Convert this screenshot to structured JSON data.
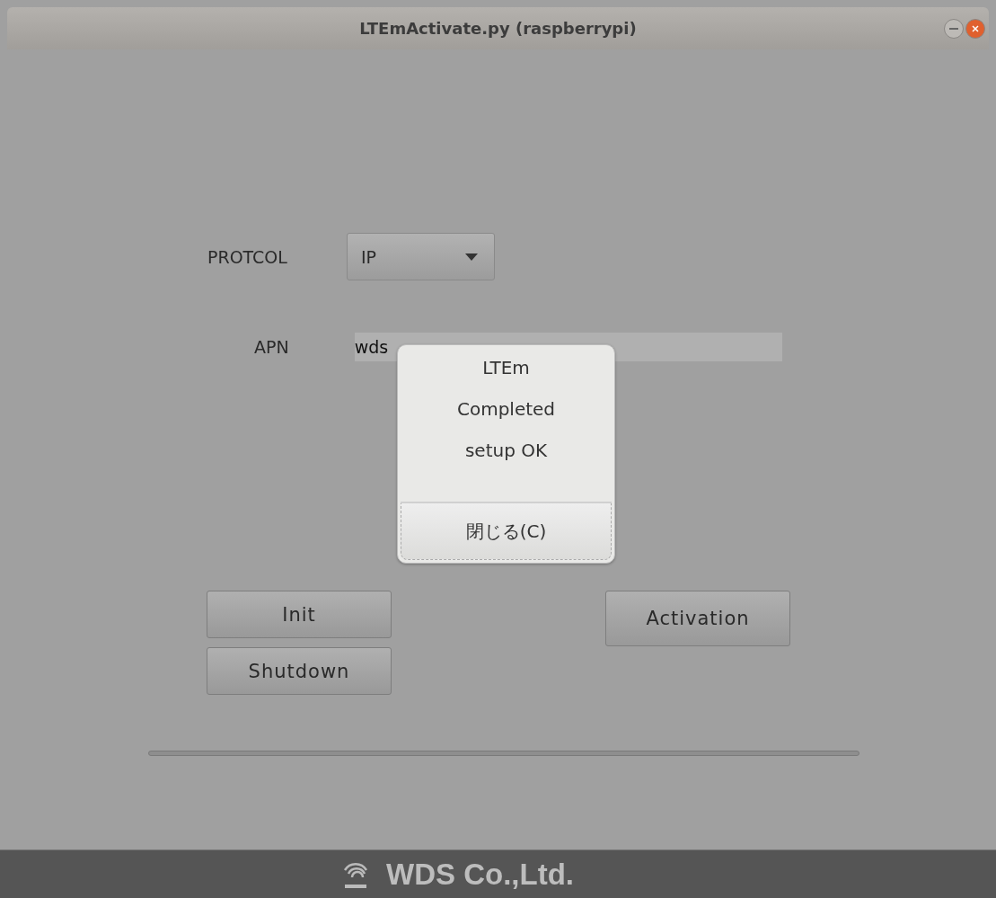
{
  "window": {
    "title": "LTEmActivate.py (raspberrypi)"
  },
  "form": {
    "protocol_label": "PROTCOL",
    "protocol_value": "IP",
    "apn_label": "APN",
    "apn_value": "wds"
  },
  "buttons": {
    "init": "Init",
    "shutdown": "Shutdown",
    "activation": "Activation"
  },
  "dialog": {
    "lines": [
      "LTEm",
      "Completed",
      "setup OK"
    ],
    "button": "閉じる(C)"
  },
  "footer": {
    "company": "WDS Co.,Ltd."
  }
}
